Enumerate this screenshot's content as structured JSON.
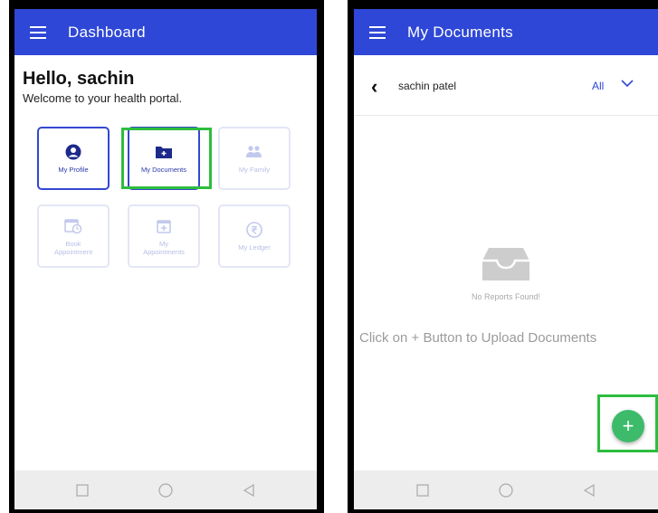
{
  "left_screen": {
    "appbar_title": "Dashboard",
    "greeting": "Hello, sachin",
    "welcome": "Welcome to your health portal.",
    "tiles": [
      {
        "label": "My Profile",
        "icon": "person-circle-icon"
      },
      {
        "label": "My Documents",
        "icon": "folder-plus-icon"
      },
      {
        "label": "My Family",
        "icon": "people-icon"
      },
      {
        "label": "Book Appointment",
        "icon": "calendar-clock-icon"
      },
      {
        "label": "My Appointments",
        "icon": "calendar-plus-icon"
      },
      {
        "label": "My Ledger",
        "icon": "rupee-icon"
      }
    ]
  },
  "right_screen": {
    "appbar_title": "My Documents",
    "patient_name": "sachin patel",
    "filter_value": "All",
    "empty_text": "No Reports Found!",
    "upload_hint": "Click on + Button to Upload Documents",
    "fab_label": "+"
  },
  "colors": {
    "appbar": "#2e47d6",
    "highlight": "#2dbd3e",
    "fab": "#3dbb6b"
  }
}
